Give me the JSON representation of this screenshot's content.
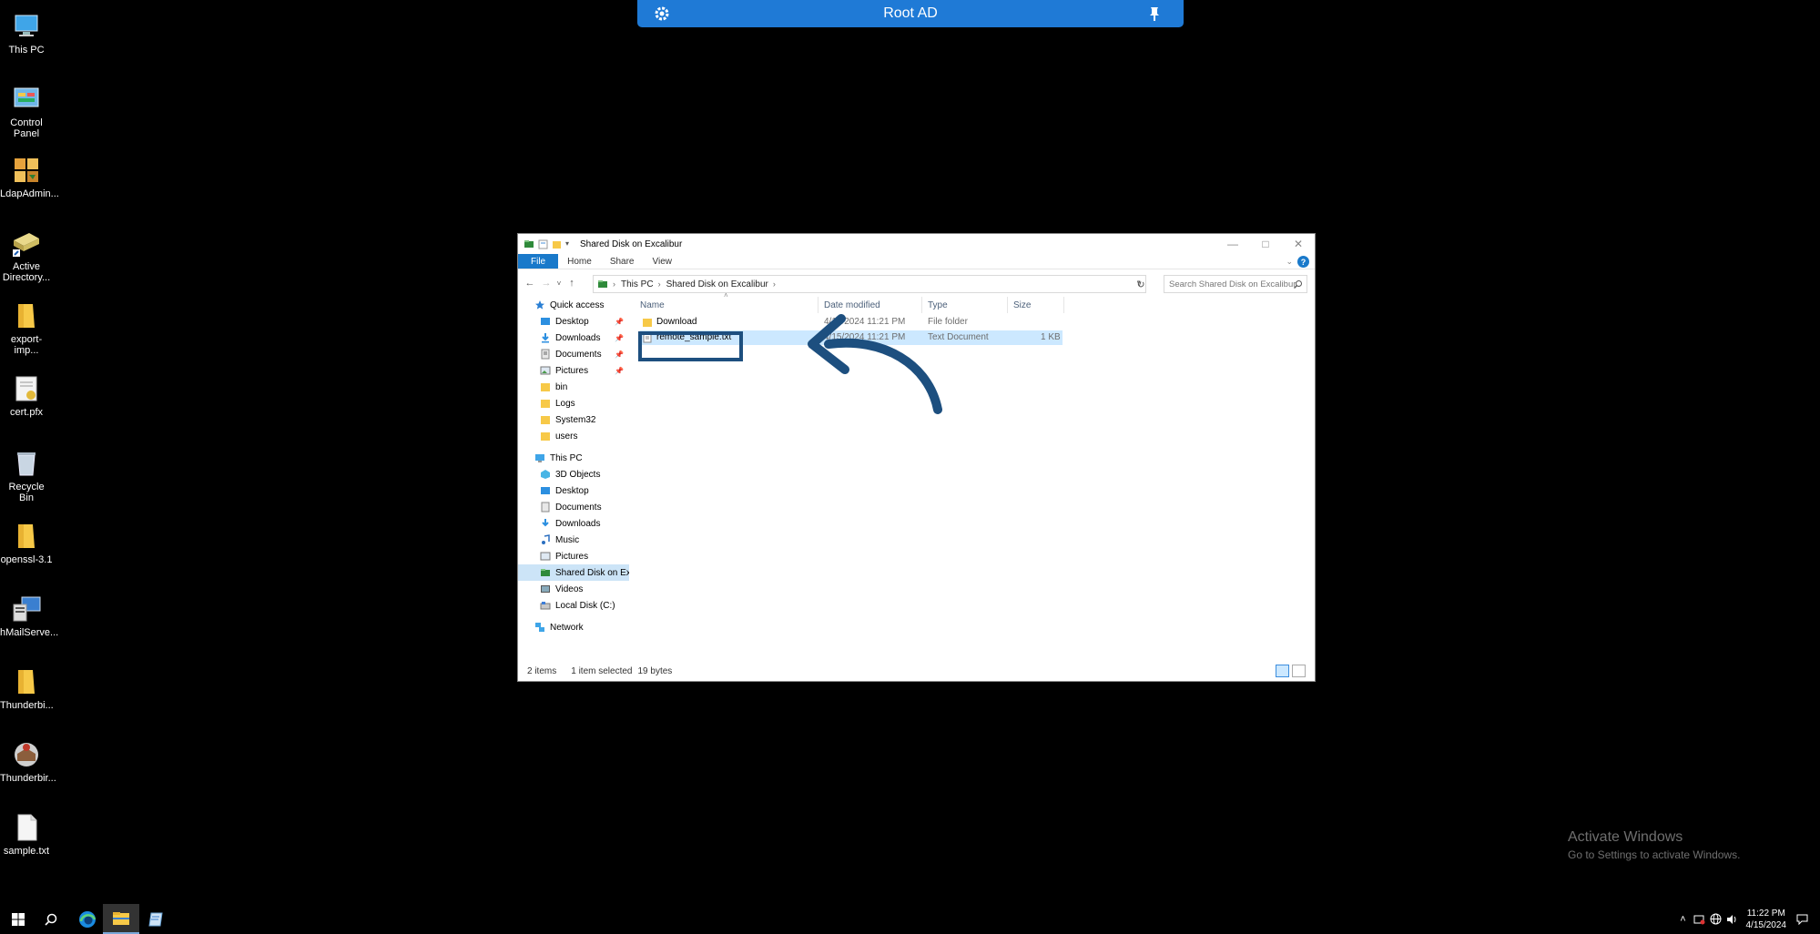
{
  "desktop": {
    "icons": [
      {
        "label": "This PC",
        "icon": "computer-icon"
      },
      {
        "label": "Control Panel",
        "icon": "control-panel-icon"
      },
      {
        "label": "LdapAdmin...",
        "icon": "ldap-admin-icon"
      },
      {
        "label": "Active Directory...",
        "icon": "active-directory-icon"
      },
      {
        "label": "export-imp...",
        "icon": "folder-icon"
      },
      {
        "label": "cert.pfx",
        "icon": "certificate-icon"
      },
      {
        "label": "Recycle Bin",
        "icon": "recycle-bin-icon"
      },
      {
        "label": "openssl-3.1",
        "icon": "folder-icon"
      },
      {
        "label": "hMailServe...",
        "icon": "mail-server-icon"
      },
      {
        "label": "Thunderbi...",
        "icon": "folder-icon"
      },
      {
        "label": "Thunderbir...",
        "icon": "thunderbird-icon"
      },
      {
        "label": "sample.txt",
        "icon": "text-file-icon"
      }
    ]
  },
  "rdp_bar": {
    "title": "Root AD"
  },
  "explorer": {
    "title": "Shared Disk on Excalibur",
    "ribbon_tabs": [
      "File",
      "Home",
      "Share",
      "View"
    ],
    "breadcrumb": [
      "This PC",
      "Shared Disk on Excalibur"
    ],
    "search_placeholder": "Search Shared Disk on Excalibur",
    "nav": {
      "quick_access": "Quick access",
      "quick_items": [
        "Desktop",
        "Downloads",
        "Documents",
        "Pictures",
        "bin",
        "Logs",
        "System32",
        "users"
      ],
      "this_pc": "This PC",
      "pc_items": [
        "3D Objects",
        "Desktop",
        "Documents",
        "Downloads",
        "Music",
        "Pictures",
        "Shared Disk on Excalibur",
        "Videos",
        "Local Disk (C:)"
      ],
      "network": "Network"
    },
    "columns": [
      "Name",
      "Date modified",
      "Type",
      "Size"
    ],
    "files": [
      {
        "name": "Download",
        "date": "4/15/2024 11:21 PM",
        "type": "File folder",
        "size": ""
      },
      {
        "name": "remote_sample.txt",
        "date": "4/15/2024 11:21 PM",
        "type": "Text Document",
        "size": "1 KB"
      }
    ],
    "status": {
      "items": "2 items",
      "selected": "1 item selected",
      "size": "19 bytes"
    }
  },
  "watermark": {
    "line1": "Activate Windows",
    "line2": "Go to Settings to activate Windows."
  },
  "taskbar": {
    "time": "11:22 PM",
    "date": "4/15/2024"
  },
  "colors": {
    "accent": "#1f7ad6",
    "selection": "#cce8ff",
    "annotation": "#1d4f7f"
  }
}
